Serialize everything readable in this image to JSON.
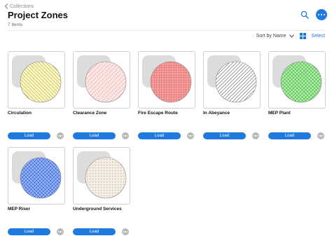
{
  "nav": {
    "back_label": "Collections"
  },
  "header": {
    "title": "Project Zones",
    "count": "7 Items"
  },
  "toolbar": {
    "sort_label": "Sort by Name",
    "select_label": "Select"
  },
  "colors": {
    "accent": "#1f7ae0"
  },
  "items": [
    {
      "label": "Circulation",
      "load_label": "Load",
      "swatch": {
        "fill": "#fff7c2",
        "stroke": "#8a8200",
        "pattern": "diag-back"
      }
    },
    {
      "label": "Clearance Zone",
      "load_label": "Load",
      "swatch": {
        "fill": "#fde6e6",
        "stroke": "#e08080",
        "pattern": "dashed-diag"
      }
    },
    {
      "label": "Fire Escape Route",
      "load_label": "Load",
      "swatch": {
        "fill": "#f7a0a0",
        "stroke": "#c22a2a",
        "pattern": "grid"
      }
    },
    {
      "label": "In Abeyance",
      "load_label": "Load",
      "swatch": {
        "fill": "#ffffff",
        "stroke": "#555555",
        "pattern": "diag"
      }
    },
    {
      "label": "MEP Plant",
      "load_label": "Load",
      "swatch": {
        "fill": "#a8f0a0",
        "stroke": "#2f8f2f",
        "pattern": "crosshatch"
      }
    },
    {
      "label": "MEP Riser",
      "load_label": "Load",
      "swatch": {
        "fill": "#8fb0ff",
        "stroke": "#1e3fb0",
        "pattern": "crosshatch"
      }
    },
    {
      "label": "Underground Services",
      "load_label": "Load",
      "swatch": {
        "fill": "#f5efe6",
        "stroke": "#9a8878",
        "pattern": "dashed-grid"
      }
    }
  ]
}
